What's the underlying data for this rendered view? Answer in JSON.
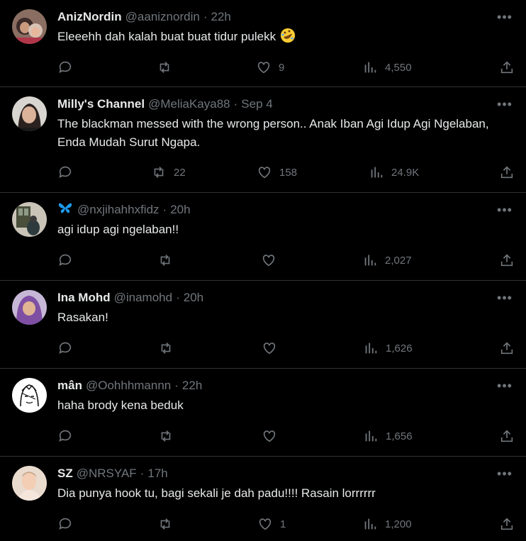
{
  "tweets": [
    {
      "name": "AnizNordin",
      "handle": "@aaniznordin",
      "time": "22h",
      "text": "Eleeehh dah kalah buat buat tidur pulekk",
      "emoji": "rolling-on-floor-laughing",
      "replies": "",
      "retweets": "",
      "likes": "9",
      "views": "4,550",
      "avatar": "avatar-woman-hijab"
    },
    {
      "name": "Milly's Channel",
      "handle": "@MeliaKaya88",
      "time": "Sep 4",
      "text": "The blackman messed with the wrong person.. Anak Iban Agi Idup Agi Ngelaban, Enda Mudah Surut Ngapa.",
      "replies": "",
      "retweets": "22",
      "likes": "158",
      "views": "24.9K",
      "avatar": "avatar-woman"
    },
    {
      "name": "",
      "handle": "@nxjihahhxfidz",
      "time": "20h",
      "name_icon": "butterfly-icon",
      "text": "agi idup agi ngelaban!!",
      "replies": "",
      "retweets": "",
      "likes": "",
      "views": "2,027",
      "avatar": "avatar-photo"
    },
    {
      "name": "Ina Mohd",
      "handle": "@inamohd",
      "time": "20h",
      "text": "Rasakan!",
      "replies": "",
      "retweets": "",
      "likes": "",
      "views": "1,626",
      "avatar": "avatar-purple-hijab"
    },
    {
      "name": "mân",
      "handle": "@Oohhhmannn",
      "time": "22h",
      "text": "haha brody kena beduk",
      "replies": "",
      "retweets": "",
      "likes": "",
      "views": "1,656",
      "avatar": "avatar-sketch"
    },
    {
      "name": "SZ",
      "handle": "@NRSYAF",
      "time": "17h",
      "text": "Dia punya hook tu, bagi sekali je dah padu!!!! Rasain lorrrrrr",
      "replies": "",
      "retweets": "",
      "likes": "1",
      "views": "1,200",
      "avatar": "avatar-pastel"
    }
  ],
  "colors": {
    "background": "#000000",
    "text": "#e7e9ea",
    "muted": "#71767b",
    "divider": "#2f3336",
    "accent": "#1d9bf0"
  },
  "more_icon": "more-horizontal-icon"
}
